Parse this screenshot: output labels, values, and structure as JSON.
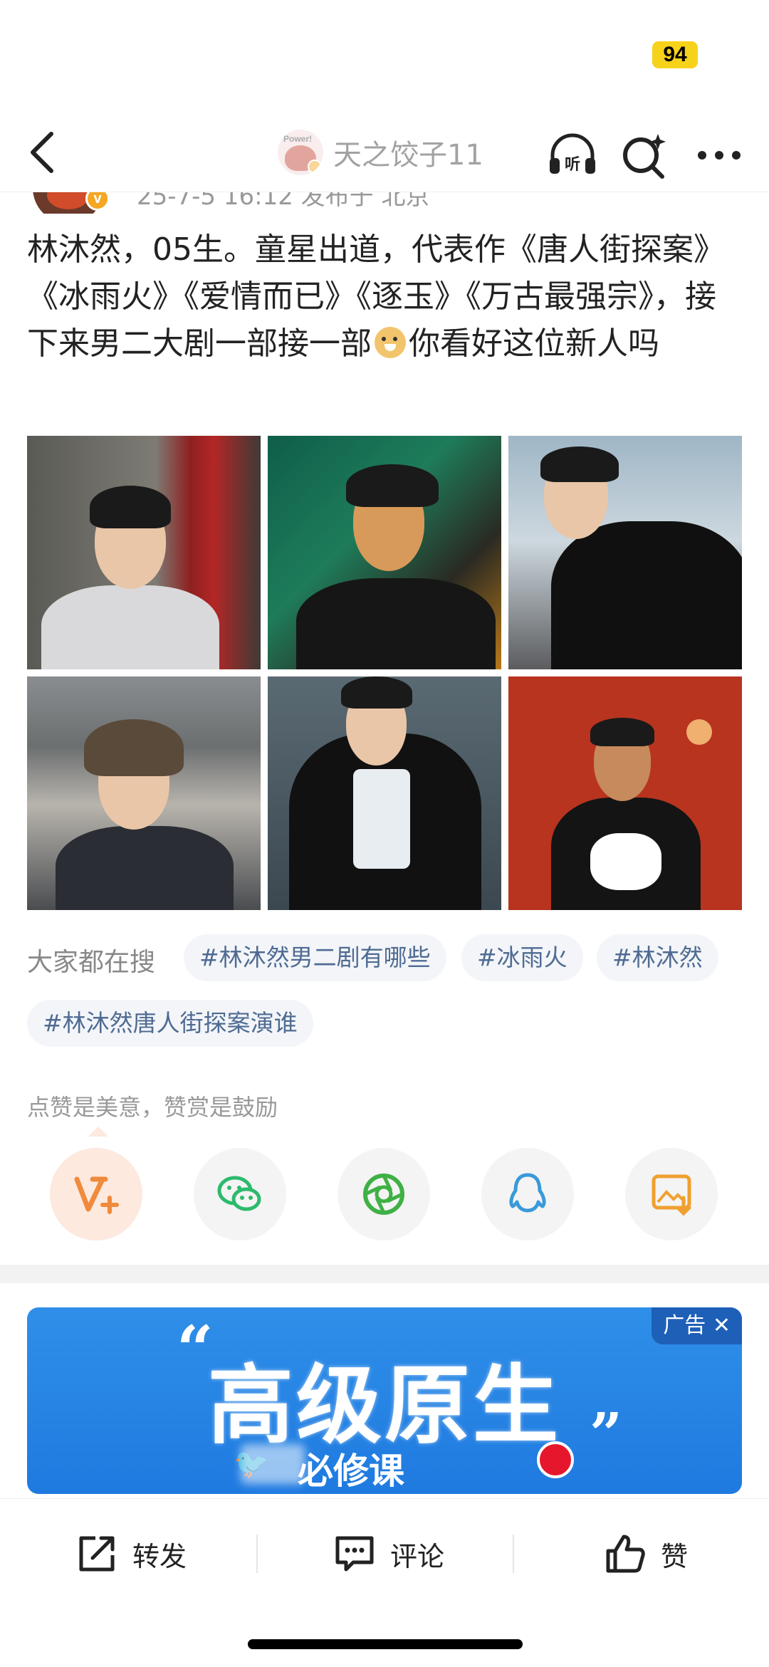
{
  "status_bar": {
    "battery": "94"
  },
  "nav": {
    "username": "天之饺子11",
    "avatar_badge_text": "Power!"
  },
  "post": {
    "meta": "25-7-5 16:12  发布于 北京",
    "text_before_emoji": "林沐然，05生。童星出道，代表作《唐人街探案》《冰雨火》《爱情而已》《逐玉》《万古最强宗》，接下来男二大剧一部接一部",
    "text_after_emoji": "你看好这位新人吗",
    "photo_count": 6
  },
  "hot_search": {
    "label": "大家都在搜",
    "tags": [
      "#林沐然男二剧有哪些",
      "#冰雨火",
      "#林沐然",
      "#林沐然唐人街探案演谁"
    ]
  },
  "share": {
    "hint": "点赞是美意，赞赏是鼓励"
  },
  "ad": {
    "headline": "高级原生",
    "quote_open": "“",
    "quote_close": "”",
    "sub": "必修课",
    "badge": "广告 ✕"
  },
  "actions": {
    "repost": "转发",
    "comment": "评论",
    "like": "赞"
  },
  "colors": {
    "accent_orange": "#f5a623",
    "link_blue": "#4f6b92",
    "ad_blue": "#2f8fe8"
  }
}
